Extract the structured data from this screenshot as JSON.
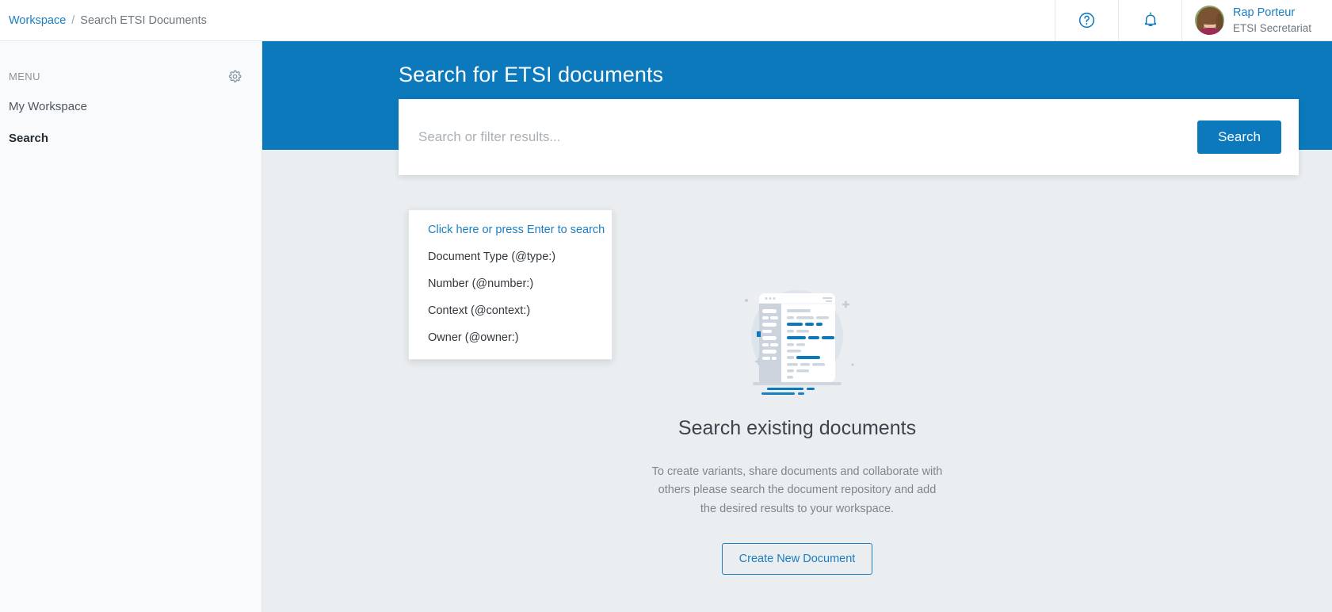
{
  "header": {
    "breadcrumb": {
      "root": "Workspace",
      "separator": "/",
      "current": "Search ETSI Documents"
    },
    "help_icon": "help-circle-icon",
    "notifications_icon": "bell-icon",
    "user": {
      "name": "Rap Porteur",
      "role": "ETSI Secretariat"
    }
  },
  "sidebar": {
    "menu_label": "MENU",
    "settings_icon": "gear-icon",
    "items": [
      {
        "label": "My Workspace",
        "active": false
      },
      {
        "label": "Search",
        "active": true
      }
    ]
  },
  "hero": {
    "title": "Search for ETSI documents"
  },
  "search": {
    "placeholder": "Search or filter results...",
    "value": "",
    "button_label": "Search",
    "suggestions": [
      {
        "label": "Click here or press Enter to search",
        "primary": true
      },
      {
        "label": "Document Type (@type:)",
        "primary": false
      },
      {
        "label": "Number (@number:)",
        "primary": false
      },
      {
        "label": "Context (@context:)",
        "primary": false
      },
      {
        "label": "Owner (@owner:)",
        "primary": false
      }
    ]
  },
  "empty_state": {
    "illustration": "document-window-illustration",
    "title": "Search existing documents",
    "description": "To create variants, share documents and collaborate with others please search the document repository and add the desired results to your workspace.",
    "button_label": "Create New Document"
  },
  "colors": {
    "brand_blue": "#0d79bd",
    "link_blue": "#1b7ec0",
    "main_bg": "#eaeef0",
    "sidebar_bg": "#f8fafb"
  }
}
